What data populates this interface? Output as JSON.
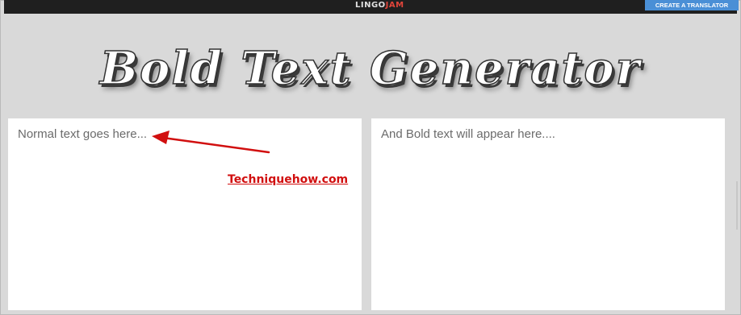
{
  "header": {
    "logo_main": "LINGO",
    "logo_accent": "JAM",
    "create_button_label": "CREATE A TRANSLATOR"
  },
  "title": "Bold Text Generator",
  "input_panel": {
    "placeholder": "Normal text goes here...",
    "value": ""
  },
  "output_panel": {
    "placeholder": "And Bold text will appear here...."
  },
  "annotation": {
    "watermark": "Techniquehow.com",
    "arrow_color": "#d10f0f"
  },
  "colors": {
    "background": "#d9d9d9",
    "topbar": "#1f1f1f",
    "button": "#4a8fd6",
    "panel": "#ffffff"
  }
}
